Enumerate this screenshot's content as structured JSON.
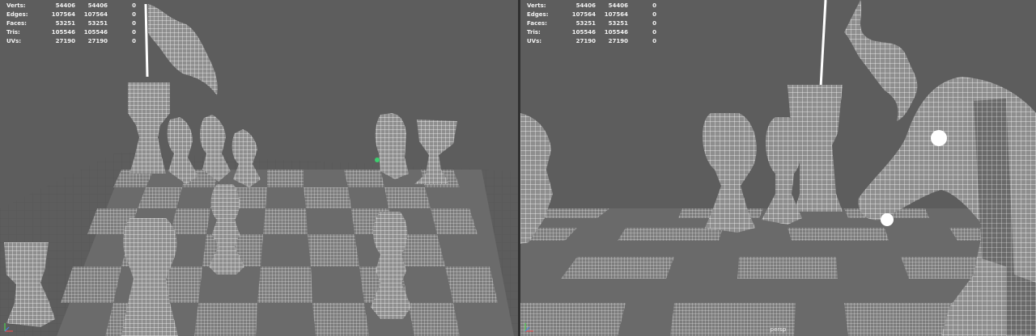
{
  "stats": [
    {
      "label": "Verts:",
      "v1": "54406",
      "v2": "54406",
      "v3": "0"
    },
    {
      "label": "Edges:",
      "v1": "107564",
      "v2": "107564",
      "v3": "0"
    },
    {
      "label": "Faces:",
      "v1": "53251",
      "v2": "53251",
      "v3": "0"
    },
    {
      "label": "Tris:",
      "v1": "105546",
      "v2": "105546",
      "v3": "0"
    },
    {
      "label": "UVs:",
      "v1": "27190",
      "v2": "27190",
      "v3": "0"
    }
  ],
  "right_viewport": {
    "camera_label": "persp"
  },
  "colors": {
    "viewport_bg": "#5d5d5d",
    "grid_line": "#505050",
    "mesh_wire": "#ffffff",
    "tile_dark": "#6d6d6d",
    "tile_light": "#8a8a8a",
    "selection_vertex": "#3ccf6e"
  },
  "icons": [
    "axis-gizmo-icon"
  ]
}
